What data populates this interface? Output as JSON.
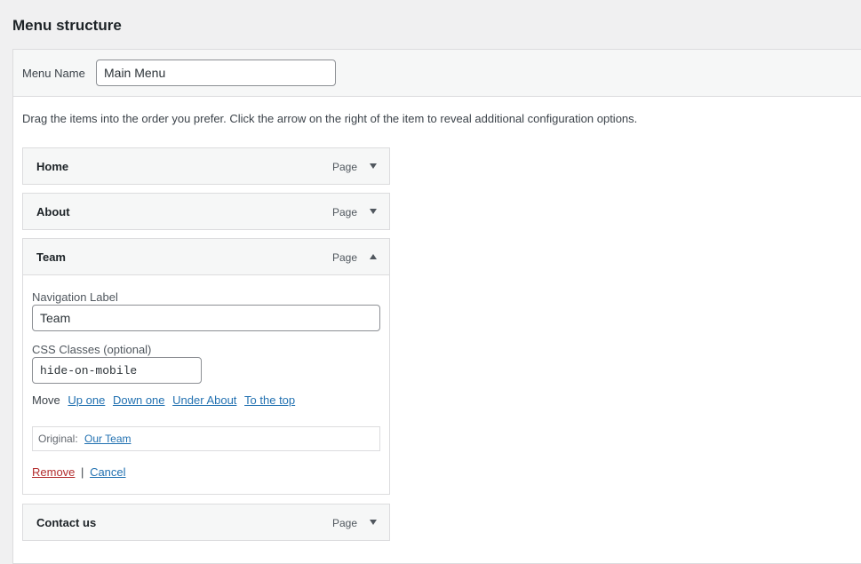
{
  "page": {
    "title": "Menu structure"
  },
  "menu_name": {
    "label": "Menu Name",
    "value": "Main Menu"
  },
  "instructions": "Drag the items into the order you prefer. Click the arrow on the right of the item to reveal additional configuration options.",
  "items": [
    {
      "title": "Home",
      "type": "Page",
      "expanded": false,
      "toggle_icon": "triangle-down-icon"
    },
    {
      "title": "About",
      "type": "Page",
      "expanded": false,
      "toggle_icon": "triangle-down-icon"
    },
    {
      "title": "Team",
      "type": "Page",
      "expanded": true,
      "toggle_icon": "triangle-up-icon"
    },
    {
      "title": "Contact us",
      "type": "Page",
      "expanded": false,
      "toggle_icon": "triangle-down-icon"
    }
  ],
  "settings": {
    "nav_label": "Navigation Label",
    "nav_value": "Team",
    "css_label": "CSS Classes (optional)",
    "css_value": "hide-on-mobile",
    "move_label": "Move",
    "move_up": "Up one",
    "move_down": "Down one",
    "move_under": "Under About",
    "move_top": "To the top",
    "original_label": "Original:",
    "original_link": "Our Team",
    "remove": "Remove",
    "separator": "|",
    "cancel": "Cancel"
  },
  "colors": {
    "link": "#2271b1",
    "remove": "#b32d2e",
    "background": "#f0f0f1",
    "item_bar": "#f6f7f7"
  }
}
